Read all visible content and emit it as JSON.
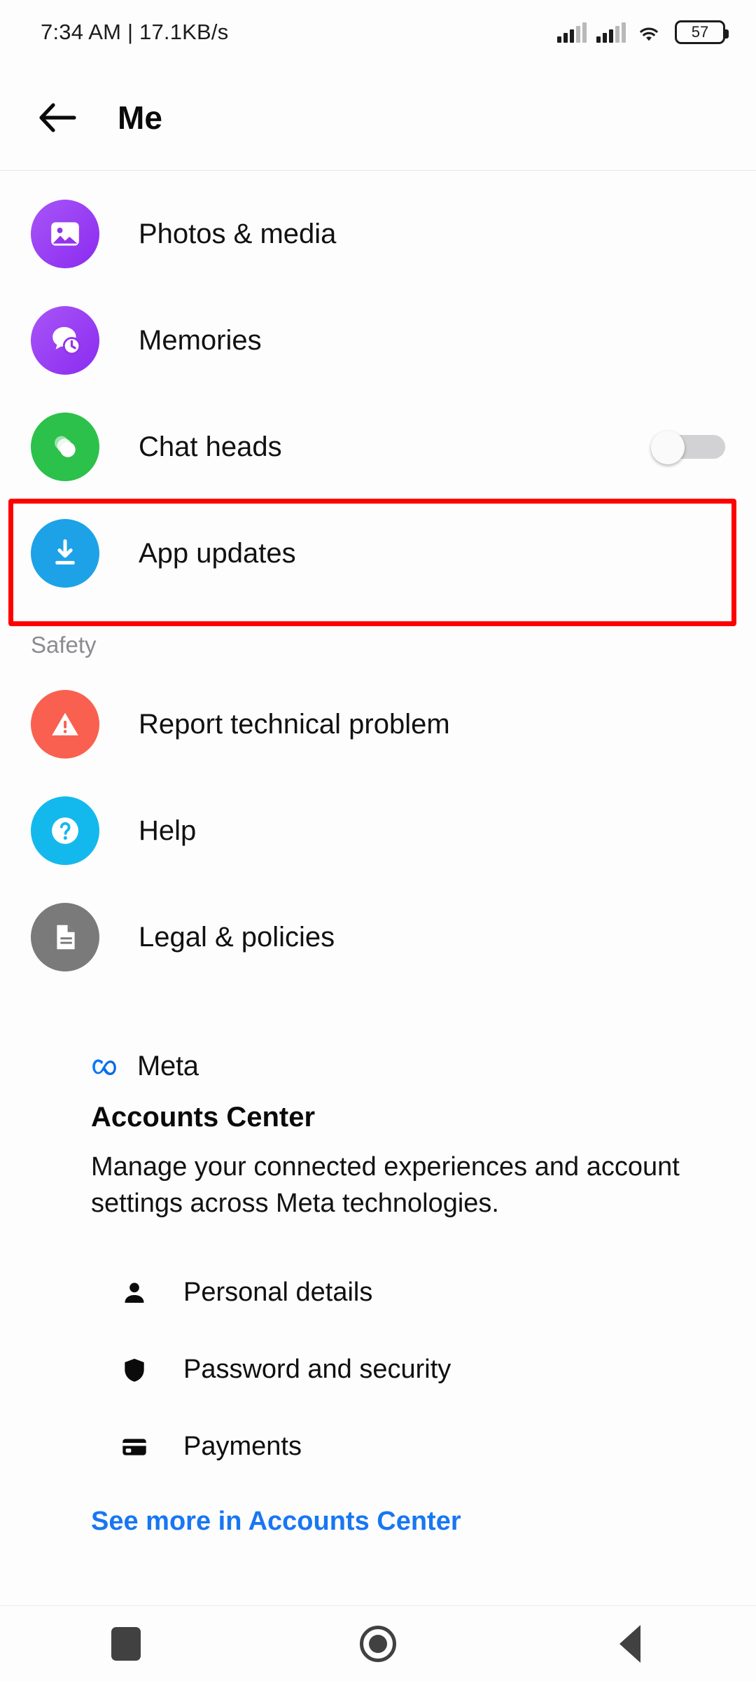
{
  "status_bar": {
    "left_text": "7:34 AM | 17.1KB/s",
    "battery_level": "57",
    "icons": [
      "signal-bars-sim1",
      "signal-bars-sim2",
      "wifi-icon",
      "battery-icon"
    ]
  },
  "app_bar": {
    "back_icon": "arrow-left-icon",
    "title": "Me"
  },
  "menu": {
    "items": [
      {
        "label": "Photos & media",
        "icon": "photo-media-icon",
        "color": "#a855f7",
        "has_toggle": false
      },
      {
        "label": "Memories",
        "icon": "memories-clock-bubble-icon",
        "color": "#a855f7",
        "has_toggle": false
      },
      {
        "label": "Chat heads",
        "icon": "chat-heads-icon",
        "color": "#2bc14a",
        "has_toggle": true,
        "toggle_state": "off"
      },
      {
        "label": "App updates",
        "icon": "download-arrow-icon",
        "color": "#1da2e8",
        "has_toggle": false,
        "highlighted": true
      }
    ]
  },
  "safety": {
    "header": "Safety",
    "items": [
      {
        "label": "Report technical problem",
        "icon": "warning-triangle-icon",
        "color": "#f9604f"
      },
      {
        "label": "Help",
        "icon": "question-mark-icon",
        "color": "#13b9ed"
      },
      {
        "label": "Legal & policies",
        "icon": "document-icon",
        "color": "#7a7a7a"
      }
    ]
  },
  "accounts_center": {
    "brand_icon": "meta-infinity-logo",
    "brand_name": "Meta",
    "heading": "Accounts Center",
    "description": "Manage your connected experiences and account settings across Meta technologies.",
    "items": [
      {
        "label": "Personal details",
        "icon": "person-icon"
      },
      {
        "label": "Password and security",
        "icon": "shield-icon"
      },
      {
        "label": "Payments",
        "icon": "credit-card-icon"
      }
    ],
    "see_more_label": "See more in Accounts Center",
    "link_color": "#1877f2"
  },
  "highlight": {
    "color": "#fe0000",
    "target": "App updates"
  },
  "nav_bar": {
    "buttons": [
      {
        "name": "recents",
        "icon": "square-icon"
      },
      {
        "name": "home",
        "icon": "circle-icon"
      },
      {
        "name": "back",
        "icon": "triangle-left-icon"
      }
    ]
  }
}
